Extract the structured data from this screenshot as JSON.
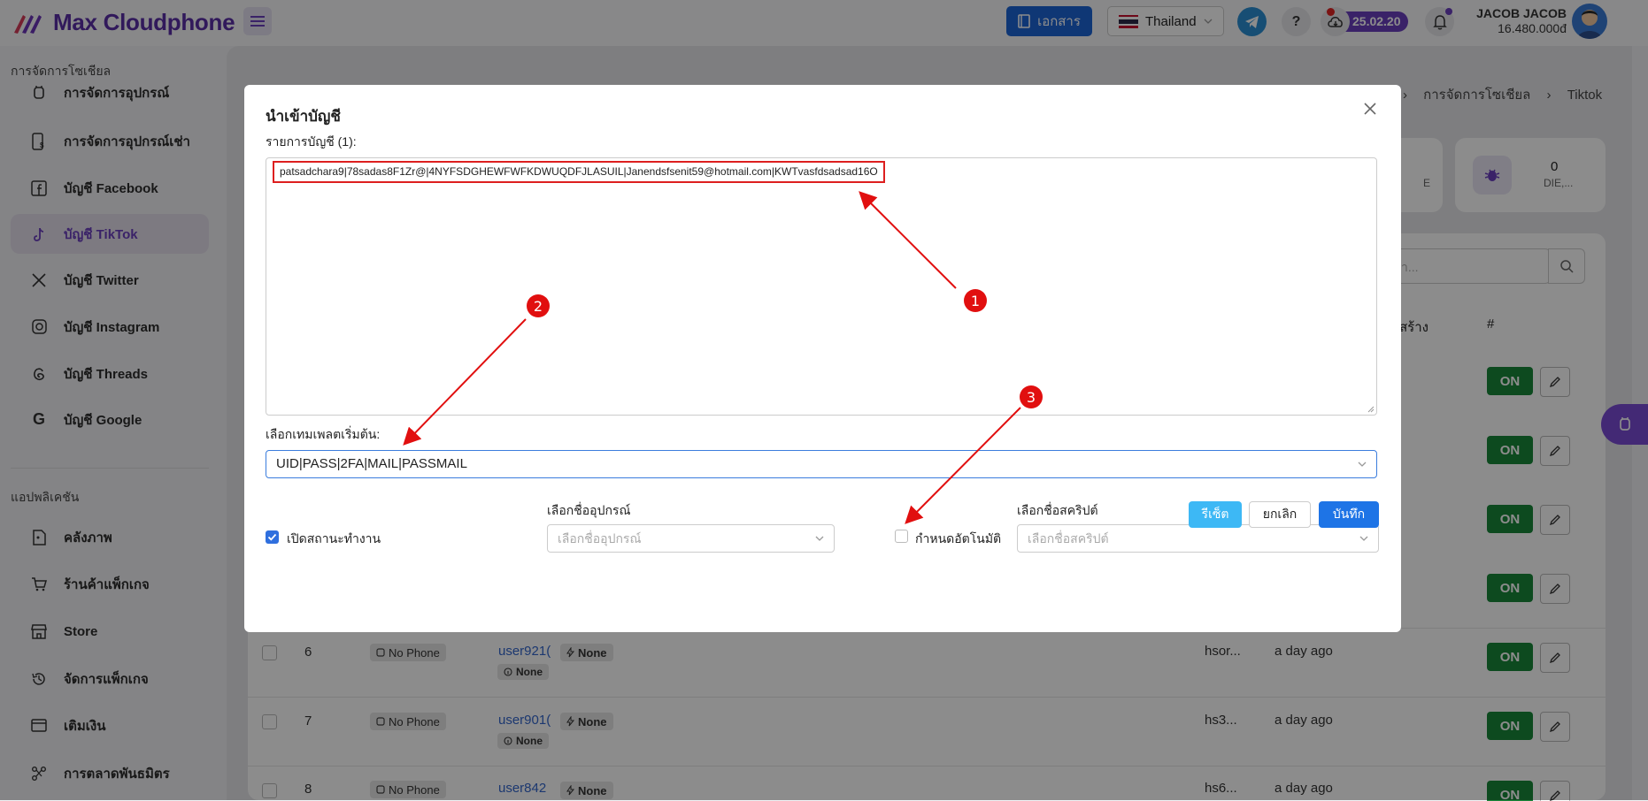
{
  "app": {
    "title": "Max Cloudphone"
  },
  "header": {
    "docs_label": "เอกสาร",
    "language": "Thailand",
    "help_label": "?",
    "version": "25.02.20",
    "user_name": "JACOB JACOB",
    "balance": "16.480.000đ"
  },
  "sidebar": {
    "section1": "การจัดการโซเชียล",
    "items1": [
      {
        "label": "การจัดการอุปกรณ์",
        "icon": "phone-icon"
      },
      {
        "label": "การจัดการอุปกรณ์เช่า",
        "icon": "rental-phone-icon"
      },
      {
        "label": "บัญชี Facebook",
        "icon": "facebook-icon"
      },
      {
        "label": "บัญชี TikTok",
        "icon": "tiktok-icon"
      },
      {
        "label": "บัญชี Twitter",
        "icon": "x-twitter-icon"
      },
      {
        "label": "บัญชี Instagram",
        "icon": "instagram-icon"
      },
      {
        "label": "บัญชี Threads",
        "icon": "threads-icon"
      },
      {
        "label": "บัญชี Google",
        "icon": "google-icon"
      }
    ],
    "section2": "แอปพลิเคชัน",
    "items2": [
      {
        "label": "คลังภาพ",
        "icon": "gallery-icon"
      },
      {
        "label": "ร้านค้าแพ็กเกจ",
        "icon": "cart-icon"
      },
      {
        "label": "Store",
        "icon": "store-icon"
      },
      {
        "label": "จัดการแพ็กเกจ",
        "icon": "history-icon"
      },
      {
        "label": "เติมเงิน",
        "icon": "wallet-icon"
      },
      {
        "label": "การตลาดพันธมิตร",
        "icon": "affiliate-icon"
      }
    ]
  },
  "background": {
    "breadcrumb": [
      "การจัดการโซเชียล",
      "Tiktok"
    ],
    "stat_value": "0",
    "stat_label": "DIE,...",
    "stat_partial_label": "E",
    "search_placeholder": "า...",
    "col_created": "สร้าง",
    "col_hash": "#",
    "rows": [
      {
        "num": "6",
        "device": "No Phone",
        "user": "user921(",
        "tag": "None",
        "status": "None",
        "owner": "hsor...",
        "time": "a day ago",
        "toggle": "ON"
      },
      {
        "num": "7",
        "device": "No Phone",
        "user": "user901(",
        "tag": "None",
        "status": "None",
        "owner": "hs3...",
        "time": "a day ago",
        "toggle": "ON"
      },
      {
        "num": "8",
        "device": "No Phone",
        "user": "user842",
        "tag": "None",
        "status": "",
        "owner": "hs6...",
        "time": "a day ago",
        "toggle": "ON"
      }
    ],
    "upper_toggles": [
      "ON",
      "ON",
      "ON",
      "ON"
    ]
  },
  "modal": {
    "title": "นำเข้าบัญชี",
    "list_label": "รายการบัญชี (1):",
    "account_text": "patsadchara9|78sadas8F1Zr@|4NYFSDGHEWFWFKDWUQDFJLASUIL|Janendsfsenit59@hotmail.com|KWTvasfdsadsad16O",
    "template_label": "เลือกเทมเพลตเริ่มต้น:",
    "template_value": "UID|PASS|2FA|MAIL|PASSMAIL",
    "open_status_label": "เปิดสถานะทำงาน",
    "device_label": "เลือกชื่ออุปกรณ์",
    "device_placeholder": "เลือกชื่ออุปกรณ์",
    "auto_label": "กำหนดอัตโนมัติ",
    "script_label": "เลือกชื่อสคริปต์",
    "script_placeholder": "เลือกชื่อสคริปต์",
    "reset_label": "รีเซ็ต",
    "cancel_label": "ยกเลิก",
    "save_label": "บันทึก",
    "open_status_checked": true,
    "auto_checked": false
  },
  "annotations": [
    "1",
    "2",
    "3"
  ],
  "colors": {
    "brand": "#5a2ea6",
    "primary": "#1e74e6",
    "toggle_on": "#19873a",
    "annotation": "#e10f0f"
  }
}
